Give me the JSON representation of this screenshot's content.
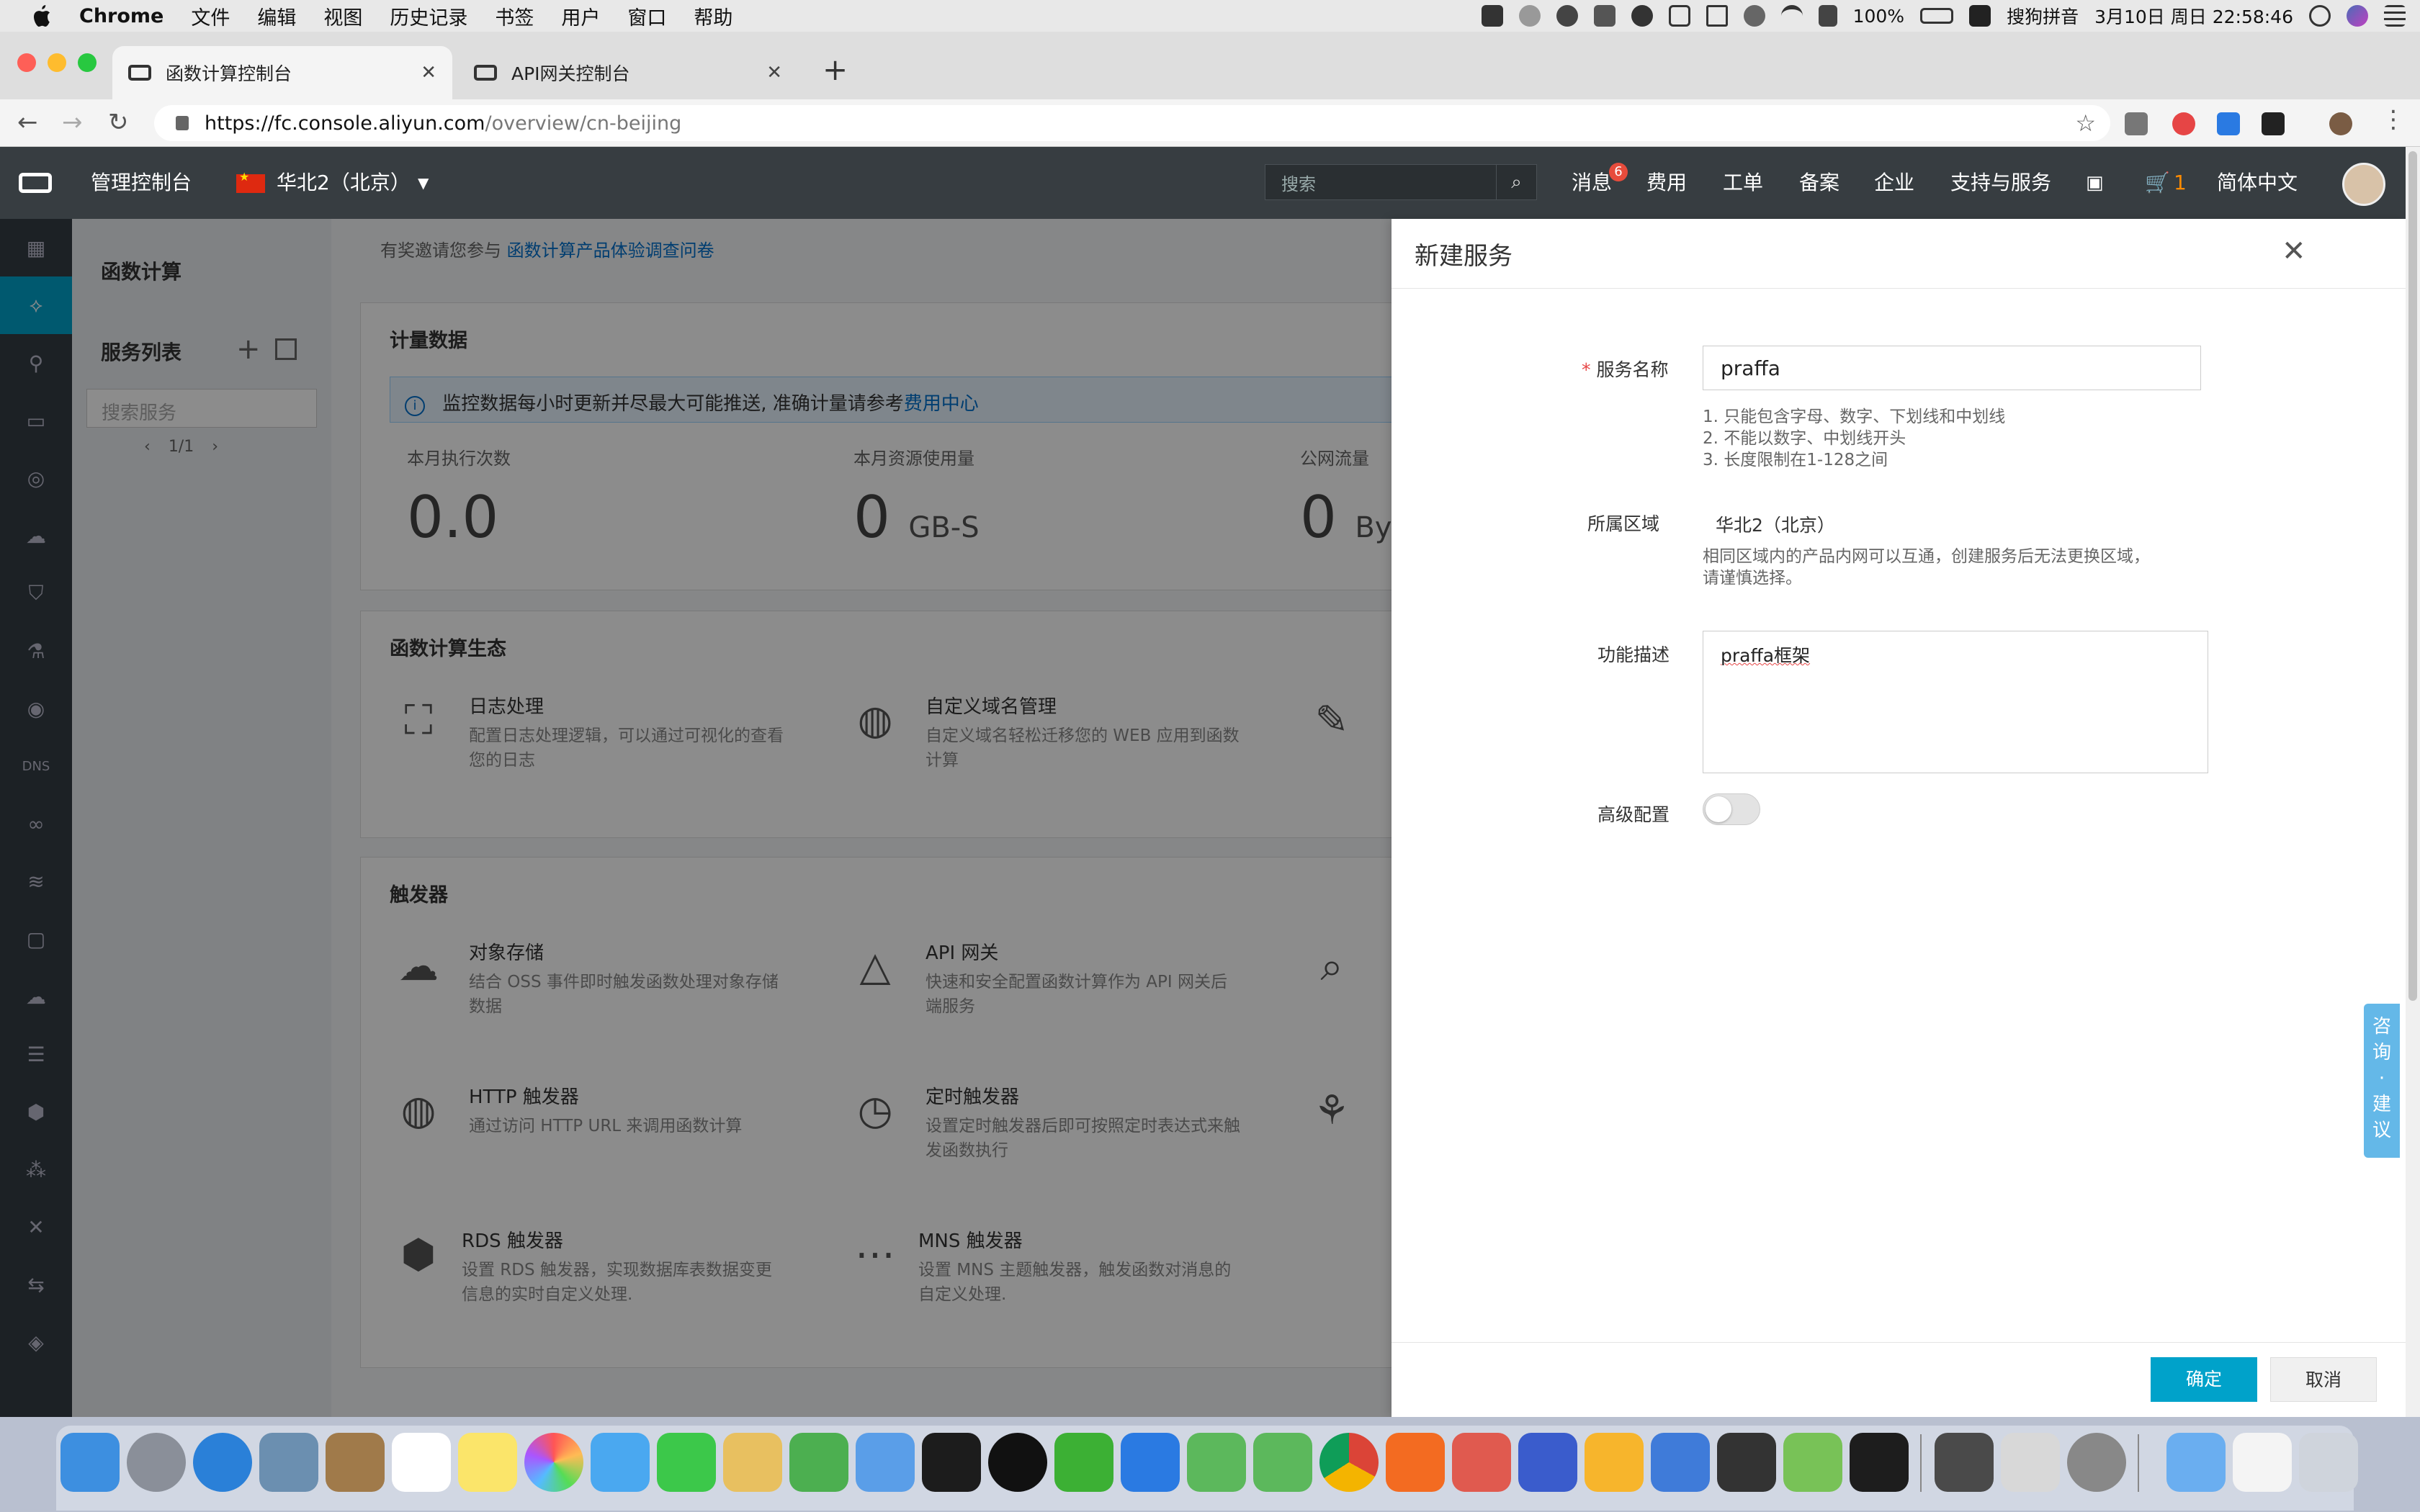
{
  "menubar": {
    "app": "Chrome",
    "items": [
      "文件",
      "编辑",
      "视图",
      "历史记录",
      "书签",
      "用户",
      "窗口",
      "帮助"
    ],
    "battery": "100%",
    "input_method": "搜狗拼音",
    "datetime": "3月10日 周日 22:58:46"
  },
  "tabs": [
    {
      "title": "函数计算控制台",
      "active": true
    },
    {
      "title": "API网关控制台",
      "active": false
    }
  ],
  "address": {
    "host": "https://fc.console.aliyun.com",
    "path": "/overview/cn-beijing"
  },
  "topnav": {
    "console": "管理控制台",
    "region": "华北2（北京）",
    "search_placeholder": "搜索",
    "messages": "消息",
    "messages_badge": "6",
    "cost": "费用",
    "tickets": "工单",
    "icp": "备案",
    "enterprise": "企业",
    "support": "支持与服务",
    "cart_count": "1",
    "language": "简体中文"
  },
  "sidebar": {
    "title": "函数计算",
    "service_list": "服务列表",
    "search_placeholder": "搜索服务",
    "pager": "1/1"
  },
  "main": {
    "invite_prefix": "有奖邀请您参与",
    "invite_link": "函数计算产品体验调查问卷",
    "metering": {
      "title": "计量数据",
      "notice": "监控数据每小时更新并尽最大可能推送, 准确计量请参考",
      "notice_link": "费用中心",
      "metrics": [
        {
          "label": "本月执行次数",
          "value": "0.0",
          "unit": ""
        },
        {
          "label": "本月资源使用量",
          "value": "0",
          "unit": "GB-S"
        },
        {
          "label": "公网流量",
          "value": "0",
          "unit": "Byt"
        }
      ]
    },
    "ecosystem": {
      "title": "函数计算生态",
      "items": [
        {
          "name": "日志处理",
          "desc": "配置日志处理逻辑，可以通过可视化的查看您的日志"
        },
        {
          "name": "自定义域名管理",
          "desc": "自定义域名轻松迁移您的 WEB 应用到函数计算"
        }
      ]
    },
    "triggers": {
      "title": "触发器",
      "items": [
        {
          "name": "对象存储",
          "desc": "结合 OSS 事件即时触发函数处理对象存储数据"
        },
        {
          "name": "API 网关",
          "desc": "快速和安全配置函数计算作为 API 网关后端服务"
        },
        {
          "name": "HTTP 触发器",
          "desc": "通过访问 HTTP URL 来调用函数计算"
        },
        {
          "name": "定时触发器",
          "desc": "设置定时触发器后即可按照定时表达式来触发函数执行"
        },
        {
          "name": "RDS 触发器",
          "desc": "设置 RDS 触发器，实现数据库表数据变更信息的实时自定义处理."
        },
        {
          "name": "MNS 触发器",
          "desc": "设置 MNS 主题触发器，触发函数对消息的自定义处理."
        }
      ]
    }
  },
  "drawer": {
    "title": "新建服务",
    "service_name_label": "服务名称",
    "service_name_value": "praffa",
    "name_rules": [
      "1. 只能包含字母、数字、下划线和中划线",
      "2. 不能以数字、中划线开头",
      "3. 长度限制在1-128之间"
    ],
    "region_label": "所属区域",
    "region_value": "华北2（北京）",
    "region_hint_1": "相同区域内的产品内网可以互通，创建服务后无法更换区域，",
    "region_hint_2": "请谨慎选择。",
    "desc_label": "功能描述",
    "desc_value": "praffa框架",
    "advanced_label": "高级配置",
    "advanced_enabled": false,
    "ok": "确定",
    "cancel": "取消"
  },
  "feedback": [
    "咨",
    "询",
    "·",
    "建",
    "议"
  ],
  "colors": {
    "accent": "#00a2ca",
    "topbar": "#373d41",
    "iconbar": "#333d44",
    "required": "#e64545",
    "link": "#0070cc"
  }
}
